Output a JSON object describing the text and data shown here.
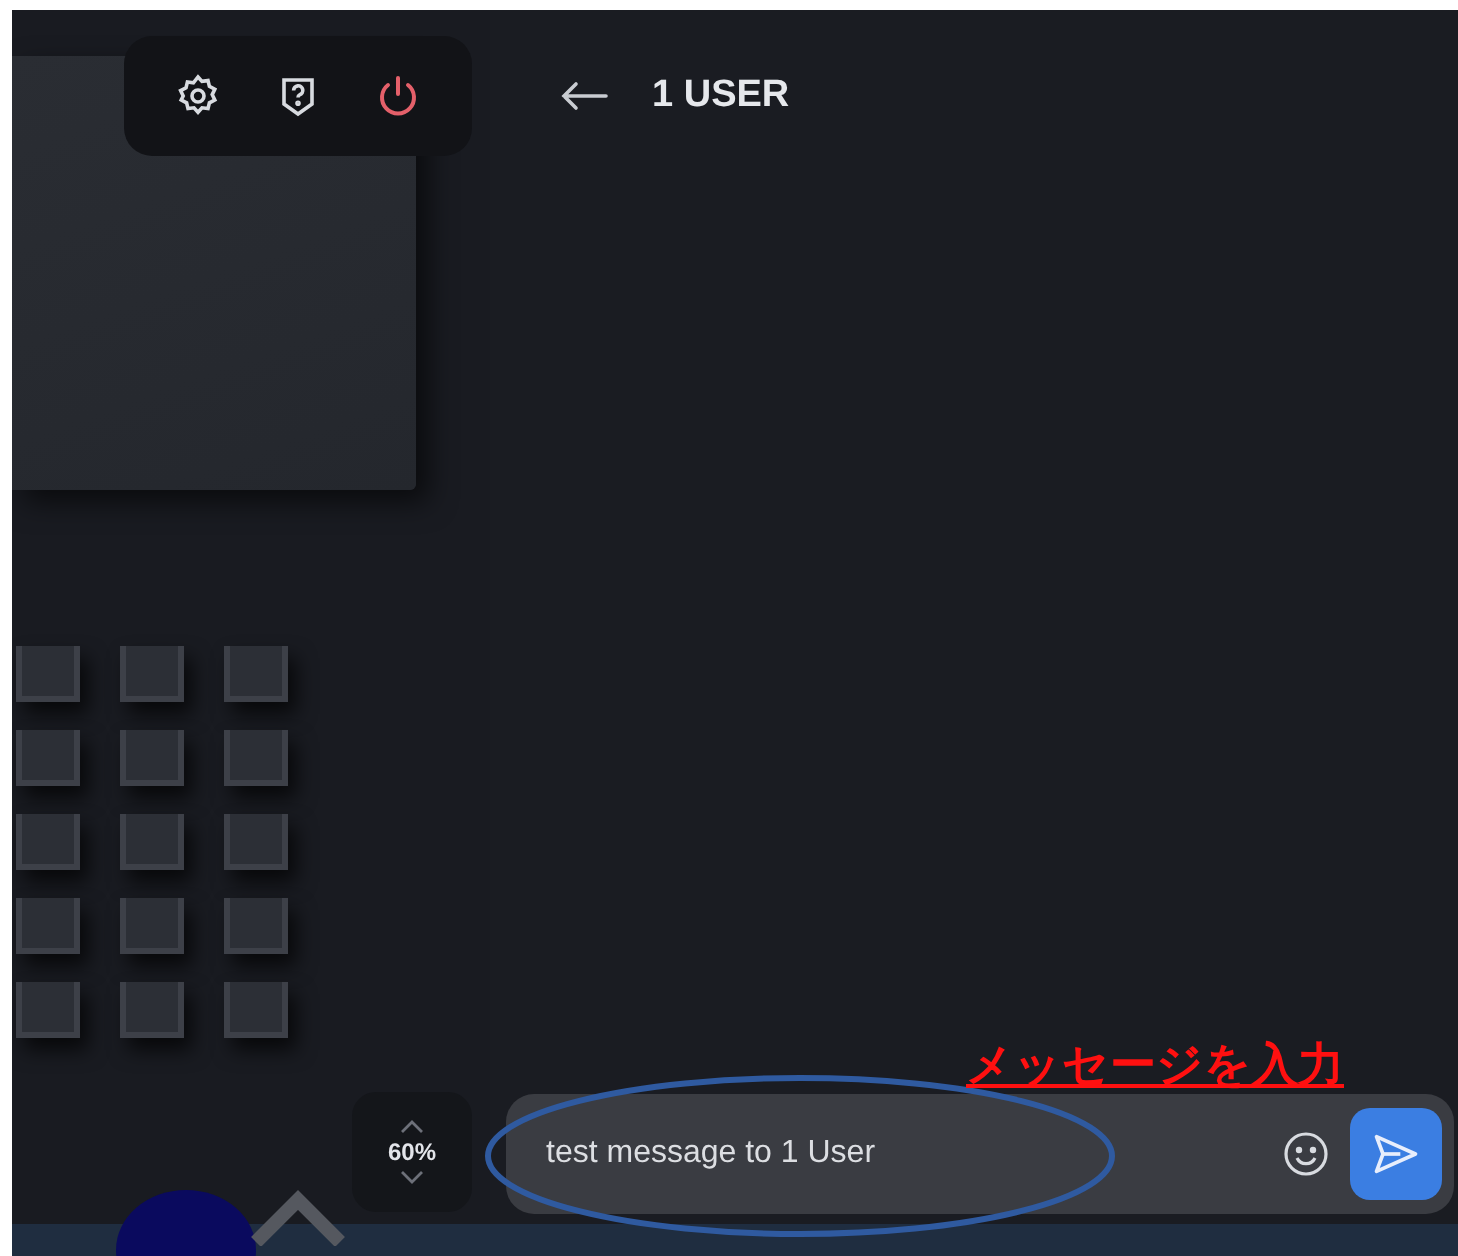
{
  "chat_header": {
    "title": "1 USER"
  },
  "zoom_control": {
    "reading": "60%"
  },
  "message_bar": {
    "value": "test message to 1 User"
  },
  "annotation": {
    "text": "メッセージを入力"
  }
}
